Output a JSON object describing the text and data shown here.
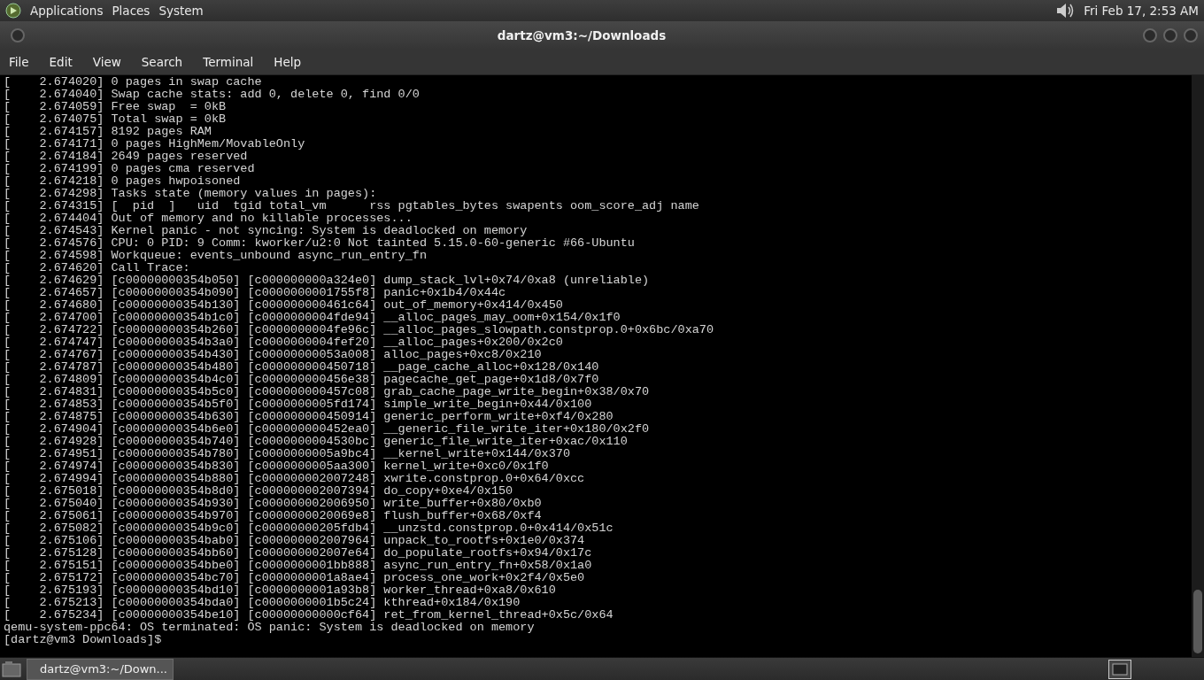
{
  "top_panel": {
    "menus": [
      "Applications",
      "Places",
      "System"
    ],
    "clock": "Fri Feb 17,  2:53 AM"
  },
  "window": {
    "title": "dartz@vm3:~/Downloads"
  },
  "menu_bar": [
    "File",
    "Edit",
    "View",
    "Search",
    "Terminal",
    "Help"
  ],
  "terminal": {
    "lines": [
      "[    2.674020] 0 pages in swap cache",
      "[    2.674040] Swap cache stats: add 0, delete 0, find 0/0",
      "[    2.674059] Free swap  = 0kB",
      "[    2.674075] Total swap = 0kB",
      "[    2.674157] 8192 pages RAM",
      "[    2.674171] 0 pages HighMem/MovableOnly",
      "[    2.674184] 2649 pages reserved",
      "[    2.674199] 0 pages cma reserved",
      "[    2.674218] 0 pages hwpoisoned",
      "[    2.674298] Tasks state (memory values in pages):",
      "[    2.674315] [  pid  ]   uid  tgid total_vm      rss pgtables_bytes swapents oom_score_adj name",
      "[    2.674404] Out of memory and no killable processes...",
      "[    2.674543] Kernel panic - not syncing: System is deadlocked on memory",
      "[    2.674576] CPU: 0 PID: 9 Comm: kworker/u2:0 Not tainted 5.15.0-60-generic #66-Ubuntu",
      "[    2.674598] Workqueue: events_unbound async_run_entry_fn",
      "[    2.674620] Call Trace:",
      "[    2.674629] [c00000000354b050] [c000000000a324e0] dump_stack_lvl+0x74/0xa8 (unreliable)",
      "[    2.674657] [c00000000354b090] [c0000000001755f8] panic+0x1b4/0x44c",
      "[    2.674680] [c00000000354b130] [c000000000461c64] out_of_memory+0x414/0x450",
      "[    2.674700] [c00000000354b1c0] [c0000000004fde94] __alloc_pages_may_oom+0x154/0x1f0",
      "[    2.674722] [c00000000354b260] [c0000000004fe96c] __alloc_pages_slowpath.constprop.0+0x6bc/0xa70",
      "[    2.674747] [c00000000354b3a0] [c0000000004fef20] __alloc_pages+0x200/0x2c0",
      "[    2.674767] [c00000000354b430] [c00000000053a008] alloc_pages+0xc8/0x210",
      "[    2.674787] [c00000000354b480] [c000000000450718] __page_cache_alloc+0x128/0x140",
      "[    2.674809] [c00000000354b4c0] [c000000000456e38] pagecache_get_page+0x1d8/0x7f0",
      "[    2.674831] [c00000000354b5c0] [c000000000457c08] grab_cache_page_write_begin+0x38/0x70",
      "[    2.674853] [c00000000354b5f0] [c0000000005fd174] simple_write_begin+0x44/0x100",
      "[    2.674875] [c00000000354b630] [c000000000450914] generic_perform_write+0xf4/0x280",
      "[    2.674904] [c00000000354b6e0] [c000000000452ea0] __generic_file_write_iter+0x180/0x2f0",
      "[    2.674928] [c00000000354b740] [c0000000004530bc] generic_file_write_iter+0xac/0x110",
      "[    2.674951] [c00000000354b780] [c0000000005a9bc4] __kernel_write+0x144/0x370",
      "[    2.674974] [c00000000354b830] [c0000000005aa300] kernel_write+0xc0/0x1f0",
      "[    2.674994] [c00000000354b880] [c000000002007248] xwrite.constprop.0+0x64/0xcc",
      "[    2.675018] [c00000000354b8d0] [c000000002007394] do_copy+0xe4/0x150",
      "[    2.675040] [c00000000354b930] [c000000002006950] write_buffer+0x80/0xb0",
      "[    2.675061] [c00000000354b970] [c0000000020069e8] flush_buffer+0x68/0xf4",
      "[    2.675082] [c00000000354b9c0] [c00000000205fdb4] __unzstd.constprop.0+0x414/0x51c",
      "[    2.675106] [c00000000354bab0] [c000000002007964] unpack_to_rootfs+0x1e0/0x374",
      "[    2.675128] [c00000000354bb60] [c000000002007e64] do_populate_rootfs+0x94/0x17c",
      "[    2.675151] [c00000000354bbe0] [c0000000001bb888] async_run_entry_fn+0x58/0x1a0",
      "[    2.675172] [c00000000354bc70] [c0000000001a8ae4] process_one_work+0x2f4/0x5e0",
      "[    2.675193] [c00000000354bd10] [c0000000001a93b8] worker_thread+0xa8/0x610",
      "[    2.675213] [c00000000354bda0] [c0000000001b5c24] kthread+0x184/0x190",
      "[    2.675234] [c00000000354be10] [c00000000000cf64] ret_from_kernel_thread+0x5c/0x64",
      "qemu-system-ppc64: OS terminated: OS panic: System is deadlocked on memory",
      "[dartz@vm3 Downloads]$"
    ]
  },
  "taskbar": {
    "tasks": [
      {
        "label": "dartz@vm3:~/Down...",
        "selected": true
      }
    ]
  }
}
